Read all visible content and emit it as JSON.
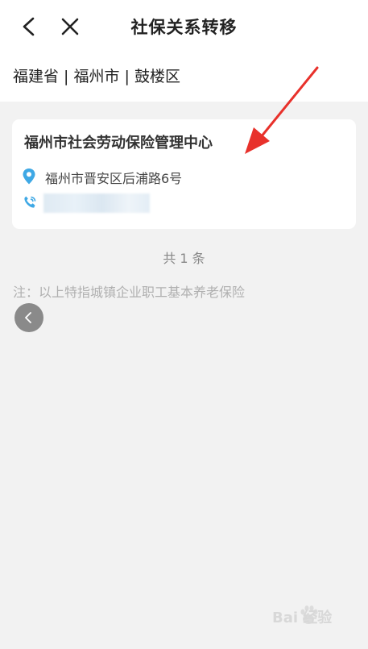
{
  "header": {
    "title": "社保关系转移",
    "back_icon": "chevron-left-icon",
    "close_icon": "close-icon"
  },
  "region": {
    "text": "福建省 | 福州市 | 鼓楼区"
  },
  "office": {
    "name": "福州市社会劳动保险管理中心",
    "address": "福州市晋安区后浦路6号",
    "address_icon": "location-pin-icon",
    "phone_icon": "phone-icon",
    "accent_color": "#3ea8e5"
  },
  "list": {
    "count_label": "共 1 条"
  },
  "note": {
    "text": "注：以上特指城镇企业职工基本养老保险"
  },
  "overlay": {
    "arrow_color": "#e8312b",
    "float_back_icon": "chevron-left-icon"
  },
  "watermark": {
    "text": "Bai  经验"
  }
}
